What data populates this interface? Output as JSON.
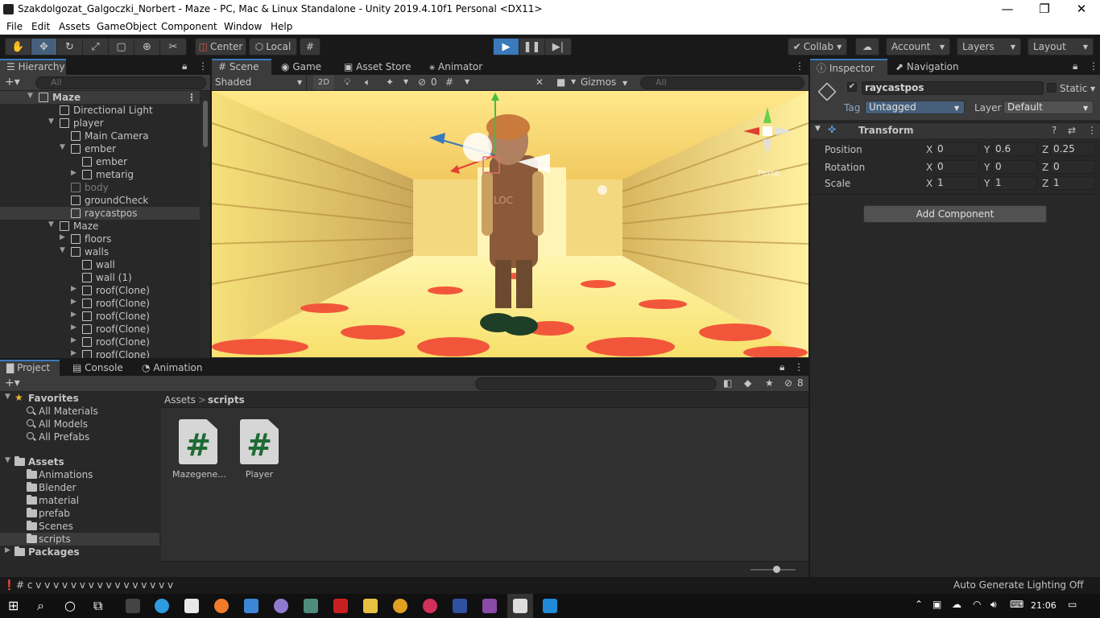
{
  "window": {
    "title": "Szakdolgozat_Galgoczki_Norbert - Maze - PC, Mac & Linux Standalone - Unity 2019.4.10f1 Personal <DX11>",
    "minimize_glyph": "—",
    "restore_glyph": "❐",
    "close_glyph": "✕"
  },
  "menu": [
    "File",
    "Edit",
    "Assets",
    "GameObject",
    "Component",
    "Window",
    "Help"
  ],
  "toolbar": {
    "pivot_label": "Center",
    "space_label": "Local",
    "collab_label": "Collab",
    "account_label": "Account",
    "layers_label": "Layers",
    "layout_label": "Layout"
  },
  "hierarchy": {
    "tab_label": "Hierarchy",
    "search_placeholder": "All",
    "rows": [
      {
        "label": "Maze",
        "depth": 0,
        "arrow": "▼",
        "type": "scene"
      },
      {
        "label": "Directional Light",
        "depth": 1,
        "arrow": "",
        "type": "obj"
      },
      {
        "label": "player",
        "depth": 1,
        "arrow": "▼",
        "type": "obj"
      },
      {
        "label": "Main Camera",
        "depth": 2,
        "arrow": "",
        "type": "obj"
      },
      {
        "label": "ember",
        "depth": 2,
        "arrow": "▼",
        "type": "obj"
      },
      {
        "label": "ember",
        "depth": 3,
        "arrow": "",
        "type": "obj"
      },
      {
        "label": "metarig",
        "depth": 3,
        "arrow": "▶",
        "type": "obj"
      },
      {
        "label": "body",
        "depth": 2,
        "arrow": "",
        "type": "dim"
      },
      {
        "label": "groundCheck",
        "depth": 2,
        "arrow": "",
        "type": "obj"
      },
      {
        "label": "raycastpos",
        "depth": 2,
        "arrow": "",
        "type": "sel"
      },
      {
        "label": "Maze",
        "depth": 1,
        "arrow": "▼",
        "type": "obj"
      },
      {
        "label": "floors",
        "depth": 2,
        "arrow": "▶",
        "type": "obj"
      },
      {
        "label": "walls",
        "depth": 2,
        "arrow": "▼",
        "type": "obj"
      },
      {
        "label": "wall",
        "depth": 3,
        "arrow": "",
        "type": "obj"
      },
      {
        "label": "wall (1)",
        "depth": 3,
        "arrow": "",
        "type": "obj"
      },
      {
        "label": "roof(Clone)",
        "depth": 3,
        "arrow": "▶",
        "type": "obj"
      },
      {
        "label": "roof(Clone)",
        "depth": 3,
        "arrow": "▶",
        "type": "obj"
      },
      {
        "label": "roof(Clone)",
        "depth": 3,
        "arrow": "▶",
        "type": "obj"
      },
      {
        "label": "roof(Clone)",
        "depth": 3,
        "arrow": "▶",
        "type": "obj"
      },
      {
        "label": "roof(Clone)",
        "depth": 3,
        "arrow": "▶",
        "type": "obj"
      },
      {
        "label": "roof(Clone)",
        "depth": 3,
        "arrow": "▶",
        "type": "obj"
      }
    ]
  },
  "scene": {
    "tabs": [
      "Scene",
      "Game",
      "Asset Store",
      "Animator"
    ],
    "shading_mode": "Shaded",
    "mode_2d": "2D",
    "hidden_count": "0",
    "gizmos_label": "Gizmos",
    "search_placeholder": "All",
    "persp_label": "Persp",
    "char_label": "LOC"
  },
  "inspector": {
    "tabs": [
      "Inspector",
      "Navigation"
    ],
    "object_name": "raycastpos",
    "static_label": "Static",
    "tag_label": "Tag",
    "tag_value": "Untagged",
    "layer_label": "Layer",
    "layer_value": "Default",
    "component_title": "Transform",
    "position_label": "Position",
    "rotation_label": "Rotation",
    "scale_label": "Scale",
    "axis_x": "X",
    "axis_y": "Y",
    "axis_z": "Z",
    "position": {
      "x": "0",
      "y": "0.6",
      "z": "0.25"
    },
    "rotation": {
      "x": "0",
      "y": "0",
      "z": "0"
    },
    "scale": {
      "x": "1",
      "y": "1",
      "z": "1"
    },
    "add_component_label": "Add Component"
  },
  "project": {
    "tabs": [
      "Project",
      "Console",
      "Animation"
    ],
    "favorites_label": "Favorites",
    "favorites": [
      "All Materials",
      "All Models",
      "All Prefabs"
    ],
    "assets_label": "Assets",
    "folders": [
      "Animations",
      "Blender",
      "material",
      "prefab",
      "Scenes",
      "scripts"
    ],
    "packages_label": "Packages",
    "breadcrumb_root": "Assets",
    "breadcrumb_sep": ">",
    "breadcrumb_current": "scripts",
    "files": [
      {
        "name": "Mazegene...",
        "glyph": "#"
      },
      {
        "name": "Player",
        "glyph": "#"
      }
    ],
    "hidden_count": "8"
  },
  "status": {
    "console_line": "# c v v v v v v v v v v v v v v v v",
    "lighting": "Auto Generate Lighting Off"
  },
  "taskbar": {
    "time": "21:06"
  }
}
